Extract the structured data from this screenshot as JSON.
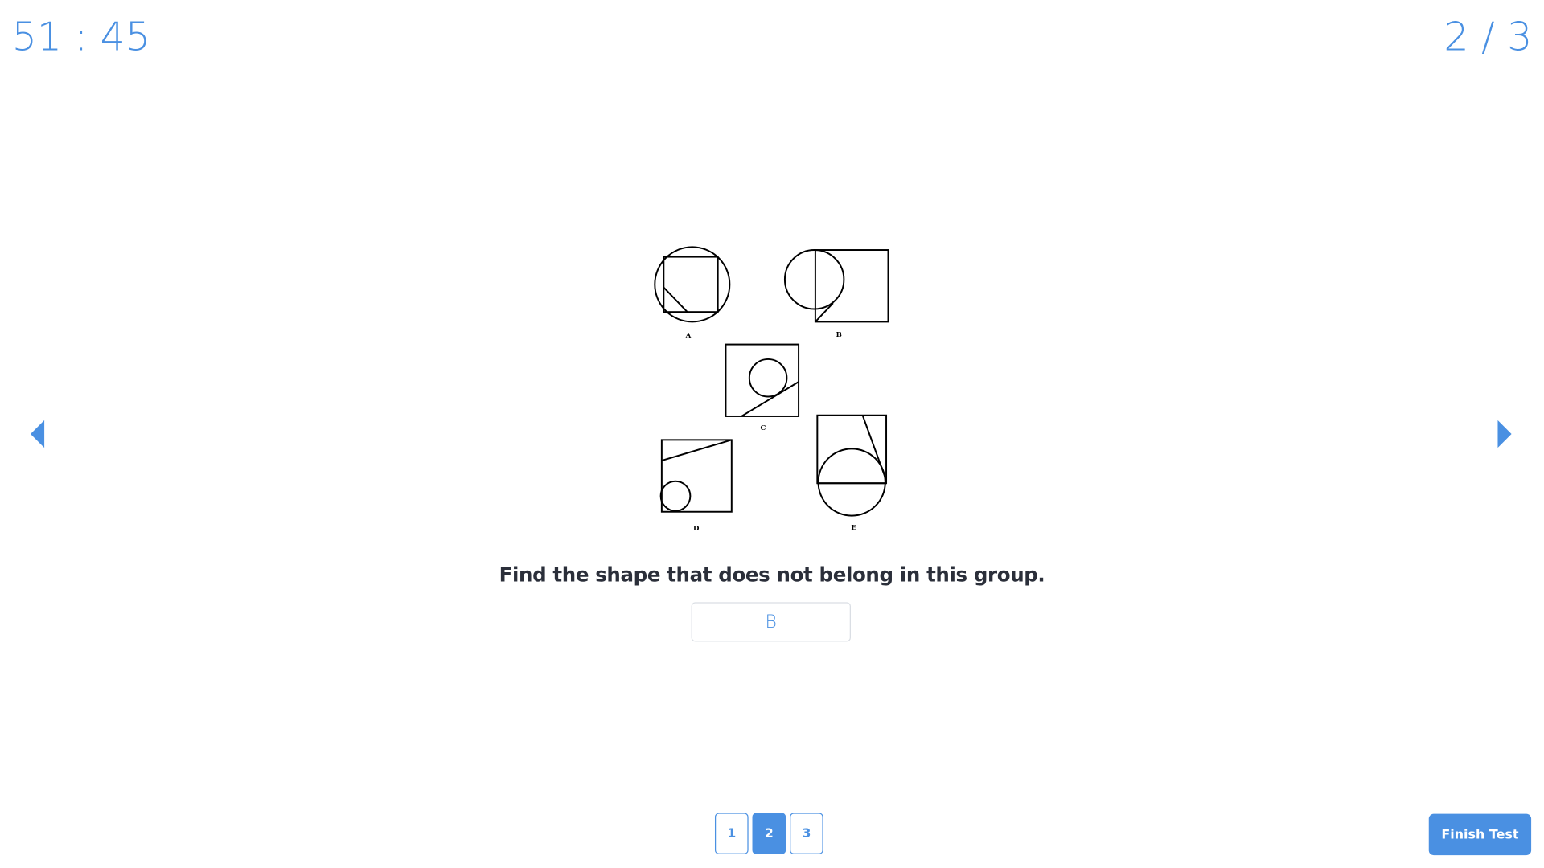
{
  "header": {
    "timer": "51 : 45",
    "progress": "2 / 3"
  },
  "question": {
    "text": "Find the shape that does not belong in this group.",
    "answer_value": "B",
    "figure_labels": {
      "a": "A",
      "b": "B",
      "c": "C",
      "d": "D",
      "e": "E"
    }
  },
  "navigation": {
    "prev_icon": "chevron-left-icon",
    "next_icon": "chevron-right-icon"
  },
  "pagination": {
    "pages": [
      "1",
      "2",
      "3"
    ],
    "current": "2"
  },
  "footer": {
    "finish_label": "Finish Test"
  },
  "colors": {
    "accent": "#4a90e2",
    "text_dark": "#2b2f3a",
    "border": "#d9dde3"
  }
}
